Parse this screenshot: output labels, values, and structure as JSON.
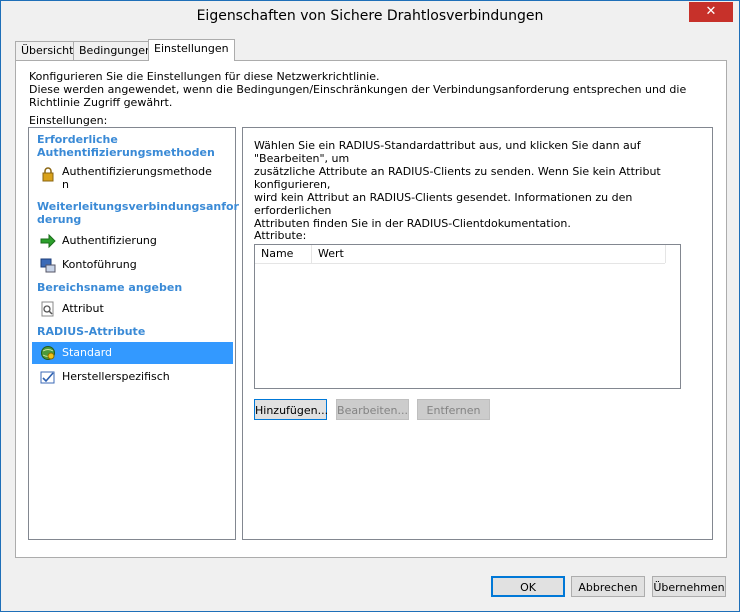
{
  "window": {
    "title": "Eigenschaften von Sichere Drahtlosverbindungen",
    "close": "✕"
  },
  "tabs": [
    {
      "label": "Übersicht"
    },
    {
      "label": "Bedingungen"
    },
    {
      "label": "Einstellungen"
    }
  ],
  "panel": {
    "description_line1": "Konfigurieren Sie die Einstellungen für diese Netzwerkrichtlinie.",
    "description_line2": "Diese werden angewendet, wenn die Bedingungen/Einschränkungen der Verbindungsanforderung entsprechen und die Richtlinie Zugriff gewährt.",
    "settings_label": "Einstellungen:"
  },
  "left": {
    "cat1_l1": "Erforderliche",
    "cat1_l2": "Authentifizierungsmethoden",
    "item1_l1": "Authentifizierungsmethode",
    "item1_l2": "n",
    "cat2_l1": "Weiterleitungsverbindungsanfor",
    "cat2_l2": "derung",
    "item2": "Authentifizierung",
    "item3": "Kontoführung",
    "cat3": "Bereichsname angeben",
    "item4": "Attribut",
    "cat4": "RADIUS-Attribute",
    "item5": "Standard",
    "item6": "Herstellerspezifisch"
  },
  "right": {
    "info_l1": "Wählen Sie ein RADIUS-Standardattribut aus, und klicken Sie dann auf \"Bearbeiten\", um",
    "info_l2": "zusätzliche Attribute an RADIUS-Clients zu senden. Wenn Sie kein Attribut konfigurieren,",
    "info_l3": "wird kein Attribut an RADIUS-Clients gesendet. Informationen zu den erforderlichen",
    "info_l4": "Attributen finden Sie in der RADIUS-Clientdokumentation.",
    "attr_label": "Attribute:",
    "col_name": "Name",
    "col_value": "Wert",
    "btn_add": "Hinzufügen...",
    "btn_edit": "Bearbeiten...",
    "btn_remove": "Entfernen"
  },
  "footer": {
    "ok": "OK",
    "cancel": "Abbrechen",
    "apply": "Übernehmen"
  }
}
